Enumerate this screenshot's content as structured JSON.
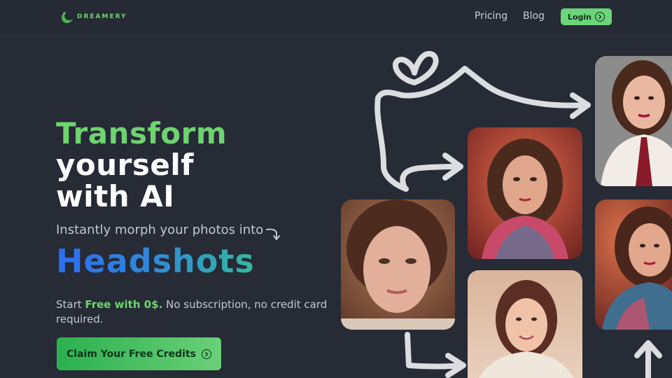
{
  "nav": {
    "logo_text": "DREAMERY",
    "links": [
      "Pricing",
      "Blog"
    ],
    "login_label": "Login"
  },
  "hero": {
    "title_line1": "Transform",
    "title_line2": "yourself",
    "title_line3": "with AI",
    "subtitle": "Instantly morph your photos into",
    "highlight_word": "Headshots",
    "start_prefix": "Start ",
    "start_highlight": "Free with 0$.",
    "start_suffix": " No subscription, no credit card required.",
    "cta_label": "Claim Your Free Credits"
  },
  "icons": {
    "logo": "moon-logo-icon",
    "login": "circle-chevron-right-icon",
    "cta": "circle-chevron-right-icon",
    "subtitle_arrow": "turn-down-arrow-icon"
  },
  "colors": {
    "background": "#262b36",
    "accent_green": "#6fd36f",
    "gradient_start": "#2d6df0",
    "gradient_end": "#35b99c"
  }
}
